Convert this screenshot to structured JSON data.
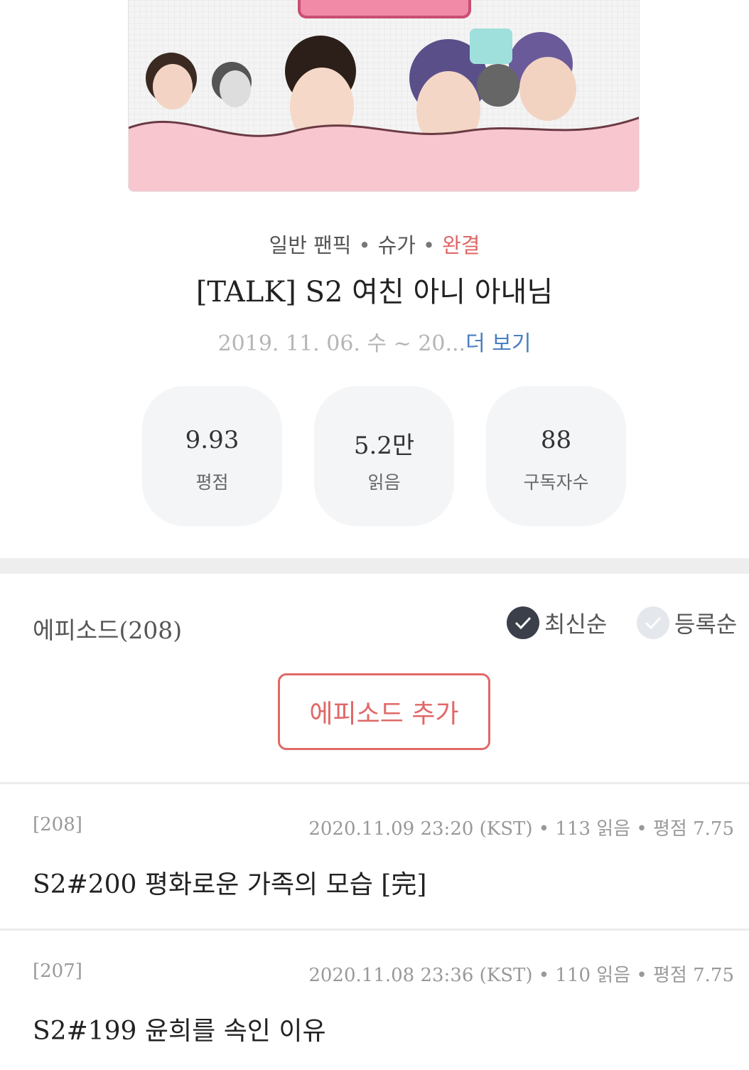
{
  "cover": {
    "image_description_icon": "fanfic-cover-art-icon",
    "accent": "#f7c6cf"
  },
  "work": {
    "category": "일반 팬픽",
    "character": "슈가",
    "status": "완결",
    "title": "[TALK] S2 여친 아니 아내님",
    "date_range": "2019. 11. 06. 수 ~ 20...",
    "more_label": "더 보기"
  },
  "stats": [
    {
      "value": "9.93",
      "label": "평점"
    },
    {
      "value": "5.2만",
      "label": "읽음"
    },
    {
      "value": "88",
      "label": "구독자수"
    }
  ],
  "episodes_header": {
    "title": "에피소드(208)",
    "sort_latest": "최신순",
    "sort_registered": "등록순",
    "add_button": "에피소드 추가"
  },
  "episodes": [
    {
      "number": "[208]",
      "info": "2020.11.09 23:20 (KST) • 113 읽음 • 평점 7.75",
      "title": "S2#200 평화로운 가족의 모습 [完]"
    },
    {
      "number": "[207]",
      "info": "2020.11.08 23:36 (KST) • 110 읽음 • 평점 7.75",
      "title": "S2#199 윤희를 속인 이유"
    }
  ],
  "colors": {
    "accent_red": "#e06868",
    "link_blue": "#4a7fc1",
    "check_dark": "#3a3f4a"
  }
}
